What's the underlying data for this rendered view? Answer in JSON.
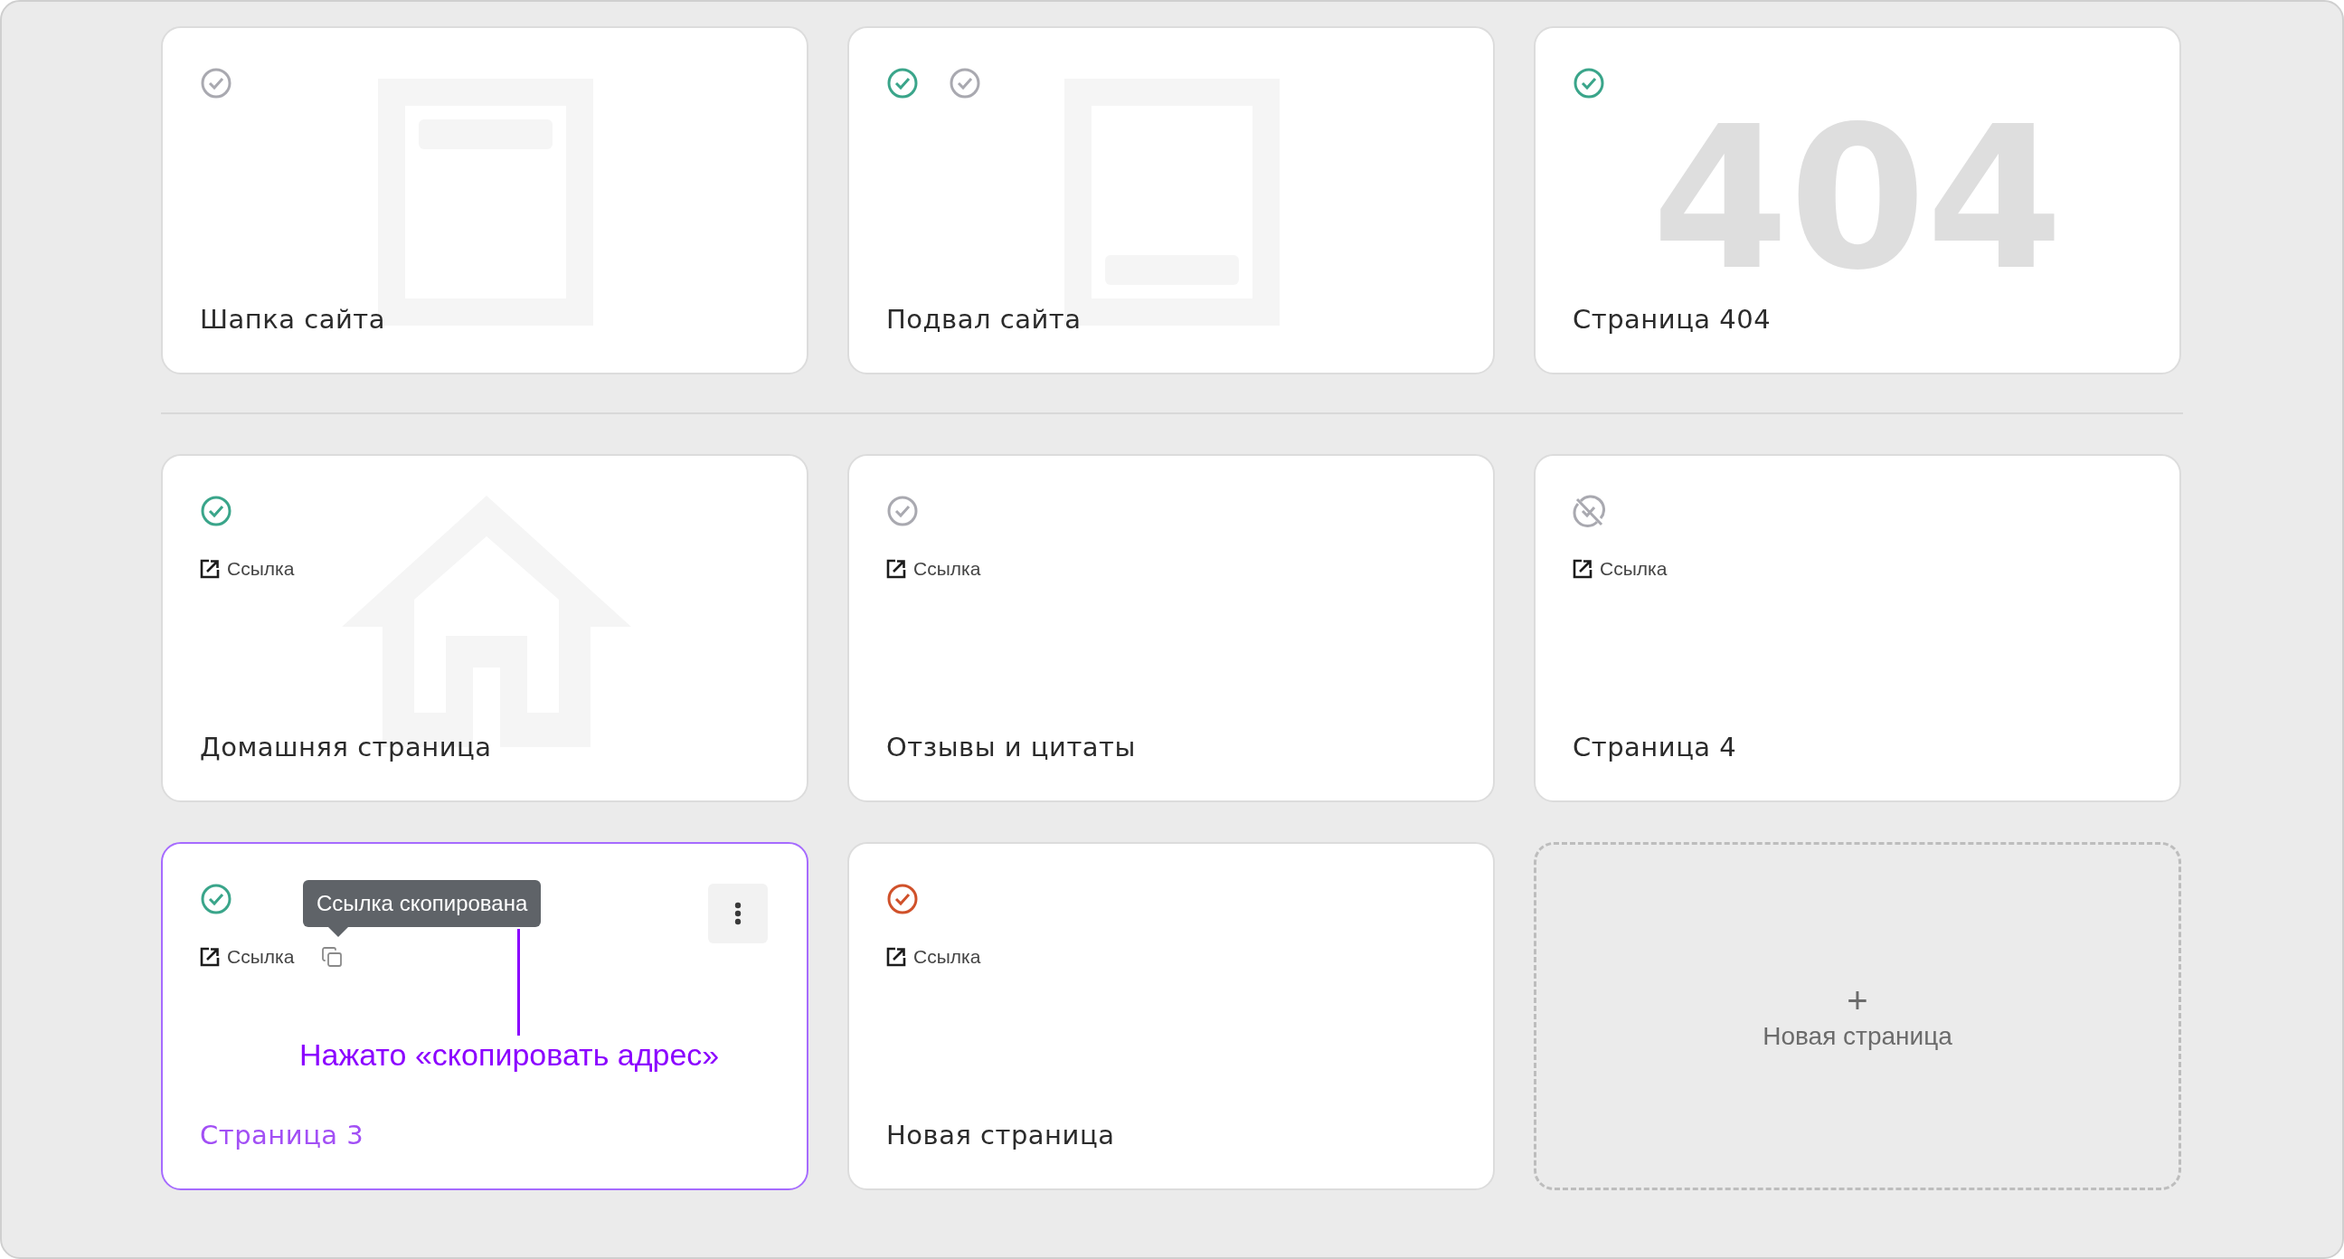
{
  "sections": [
    {
      "cards": [
        {
          "kind": "header",
          "title": "Шапка сайта",
          "selected": false,
          "statuses": [
            {
              "kind": "draft"
            }
          ]
        },
        {
          "kind": "footer",
          "title": "Подвал сайта",
          "selected": false,
          "statuses": [
            {
              "kind": "published"
            },
            {
              "kind": "draft"
            }
          ]
        },
        {
          "kind": "error_page",
          "title": "Страница 404",
          "selected": false,
          "backdrop_text": "404",
          "statuses": [
            {
              "kind": "published"
            }
          ]
        }
      ]
    },
    {
      "cards": [
        {
          "kind": "home",
          "title": "Домашняя страница",
          "selected": false,
          "statuses": [
            {
              "kind": "published"
            }
          ],
          "link": "Ссылка"
        },
        {
          "kind": "plain",
          "title": "Отзывы и цитаты",
          "selected": false,
          "statuses": [
            {
              "kind": "draft"
            }
          ],
          "link": "Ссылка"
        },
        {
          "kind": "plain",
          "title": "Страница 4",
          "selected": false,
          "statuses": [
            {
              "kind": "hidden"
            }
          ],
          "link": "Ссылка"
        },
        {
          "kind": "plain",
          "title": "Страница 3",
          "selected": true,
          "statuses": [
            {
              "kind": "published"
            }
          ],
          "link": "Ссылка",
          "copy_button": true,
          "tooltip": "Ссылка скопирована",
          "menu_button": true,
          "annotation": "Нажато «скопировать адрес»"
        },
        {
          "kind": "plain",
          "title": "Новая страница",
          "selected": false,
          "statuses": [
            {
              "kind": "error"
            }
          ],
          "link": "Ссылка"
        },
        {
          "kind": "add",
          "plus": "+",
          "title": "Новая страница"
        }
      ]
    }
  ]
}
